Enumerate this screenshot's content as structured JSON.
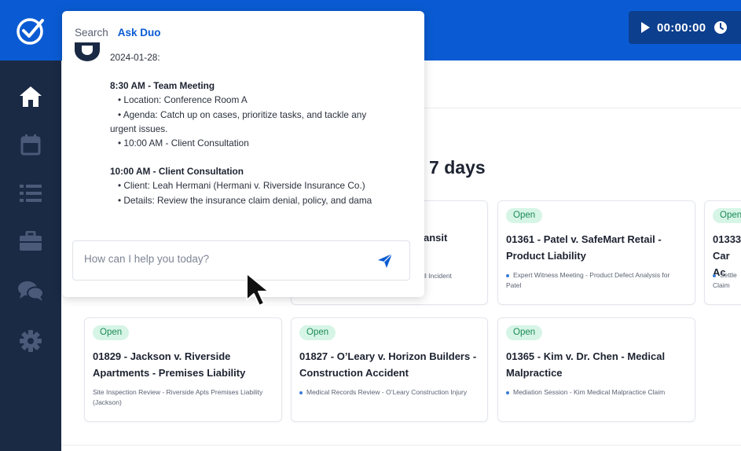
{
  "header": {
    "timer": "00:00:00",
    "colors": {
      "topbar": "#0a5bd3",
      "timer_bg": "#0d3f8f",
      "sidebar": "#1a2a45"
    }
  },
  "sidebar": {
    "items": [
      {
        "icon": "home-icon"
      },
      {
        "icon": "calendar-icon"
      },
      {
        "icon": "list-icon"
      },
      {
        "icon": "briefcase-icon"
      },
      {
        "icon": "chat-icon"
      },
      {
        "icon": "gear-icon"
      }
    ]
  },
  "main": {
    "title_fragment": "t 7 days",
    "cards": [
      {
        "badge": "",
        "title": "ansit",
        "sub": "ll Incident"
      },
      {
        "badge": "Open",
        "title": "01361 - Patel v. SafeMart Retail - Product Liability",
        "sub": "Expert Witness Meeting - Product Defect Analysis for Patel"
      },
      {
        "badge": "Open",
        "title": "01333 Car Ac",
        "sub": "Settle Claim"
      },
      {
        "badge": "Open",
        "title": "01829 - Jackson v. Riverside Apartments - Premises Liability",
        "sub": "Site Inspection Review - Riverside Apts Premises Liability (Jackson)"
      },
      {
        "badge": "Open",
        "title": "01827 - O’Leary v. Horizon Builders - Construction Accident",
        "sub": "Medical Records Review - O’Leary Construction Injury"
      },
      {
        "badge": "Open",
        "title": "01365 - Kim v. Dr. Chen - Medical Malpractice",
        "sub": "Mediation Session - Kim Medical Malpractice Claim"
      }
    ],
    "badge_color": "#d6f5e6",
    "badge_text_color": "#1c8a55"
  },
  "panel": {
    "tabs": [
      {
        "label": "Search",
        "active": false
      },
      {
        "label": "Ask Duo",
        "active": true
      }
    ],
    "message": {
      "date": "2024-01-28:",
      "event1_heading": "8:30 AM - Team Meeting",
      "event1_location": "• Location: Conference Room A",
      "event1_agenda": "• Agenda: Catch up on cases, prioritize tasks, and tackle any",
      "event1_agenda_cont": "urgent issues.",
      "event1_next": "• 10:00 AM - Client Consultation",
      "event2_heading": "10:00 AM - Client Consultation",
      "event2_client": "• Client: Leah Hermani (Hermani v. Riverside Insurance Co.)",
      "event2_details": "• Details: Review the insurance claim denial, policy, and dama"
    },
    "input": {
      "placeholder": "How can I help you today?",
      "value": ""
    }
  }
}
